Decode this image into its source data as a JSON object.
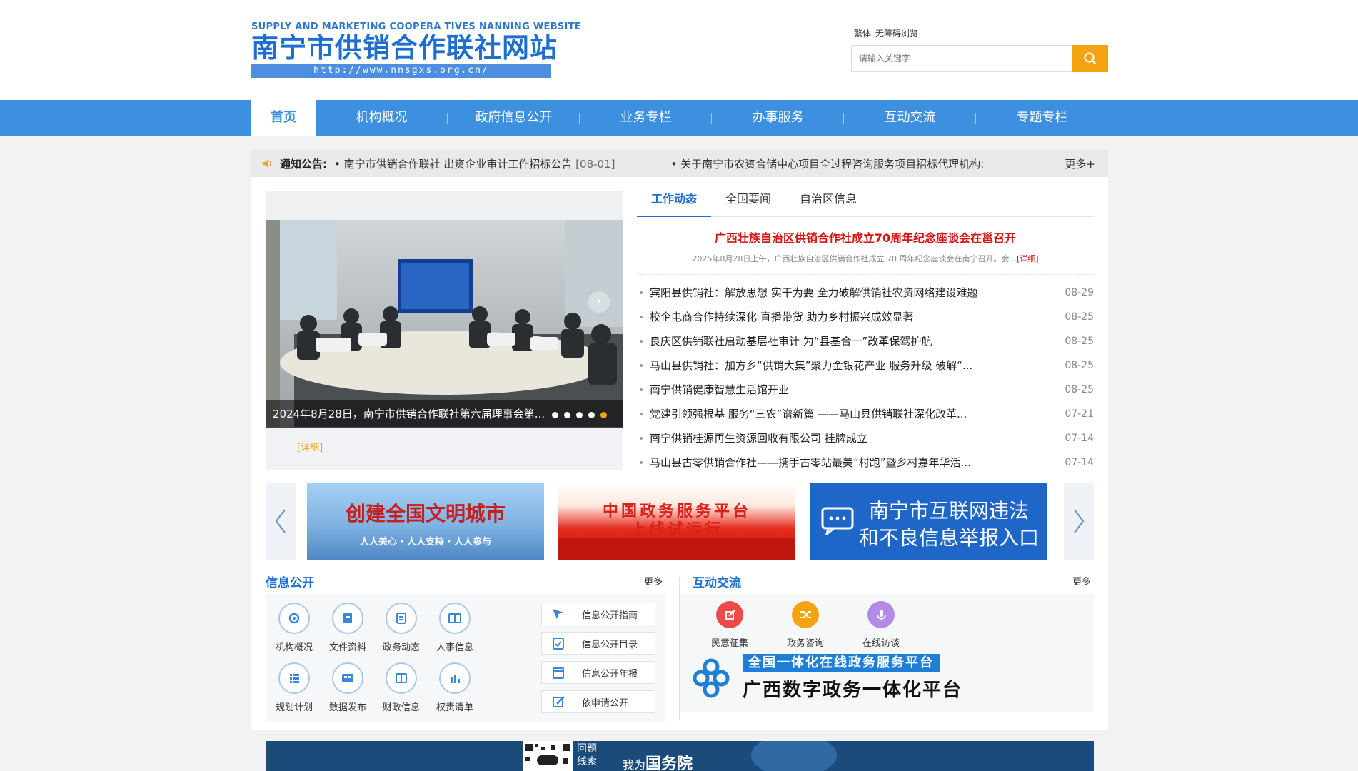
{
  "site": {
    "logo_en": "SUPPLY AND MARKETING COOPERA TIVES NANNING WEBSITE",
    "logo_cn": "南宁市供销合作联社网站",
    "logo_url": "http://www.nnsgxs.org.cn/"
  },
  "tools": {
    "traditional": "繁体",
    "accessible": "无障碍浏览"
  },
  "search": {
    "placeholder": "请输入关键字",
    "button_icon": "search-icon"
  },
  "nav": {
    "items": [
      {
        "label": "首页",
        "active": true
      },
      {
        "label": "机构概况"
      },
      {
        "label": "政府信息公开"
      },
      {
        "label": "业务专栏"
      },
      {
        "label": "办事服务"
      },
      {
        "label": "互动交流"
      },
      {
        "label": "专题专栏"
      }
    ]
  },
  "notice": {
    "label": "通知公告:",
    "items": [
      {
        "text": "• 南宁市供销合作联社 出资企业审计工作招标公告",
        "date": "[08-01]"
      },
      {
        "text": "• 关于南宁市农资合储中心项目全过程咨询服务项目招标代理机构:",
        "date": ""
      }
    ],
    "more": "更多+"
  },
  "slider": {
    "caption": "2024年8月28日，南宁市供销合作联社第六届理事会第...",
    "detail": "[详细]",
    "dots": 5,
    "active_dot": 5
  },
  "news": {
    "tabs": [
      "工作动态",
      "全国要闻",
      "自治区信息"
    ],
    "active_tab": 0,
    "headline": "广西壮族自治区供销合作社成立70周年纪念座谈会在邕召开",
    "summary": "2025年8月28日上午，广西壮族自治区供销合作社成立 70 周年纪念座谈会在南宁召开。会...",
    "summary_link": "[详细]",
    "items": [
      {
        "title": "宾阳县供销社：解放思想   实干为要 全力破解供销社农资网络建设难题",
        "date": "08-29"
      },
      {
        "title": "校企电商合作持续深化 直播带货 助力乡村振兴成效显著",
        "date": "08-25"
      },
      {
        "title": "良庆区供销联社启动基层社审计 为“县基合一”改革保驾护航",
        "date": "08-25"
      },
      {
        "title": "马山县供销社：加方乡“供销大集”聚力金银花产业 服务升级 破解“...",
        "date": "08-25"
      },
      {
        "title": "南宁供销健康智慧生活馆开业",
        "date": "08-25"
      },
      {
        "title": "党建引领强根基 服务“三农”谱新篇 ——马山县供销联社深化改革...",
        "date": "07-21"
      },
      {
        "title": "南宁供销桂源再生资源回收有限公司 挂牌成立",
        "date": "07-14"
      },
      {
        "title": "马山县古零供销合作社——携手古零站最美“村跑”暨乡村嘉年华活...",
        "date": "07-14"
      }
    ]
  },
  "banners": [
    {
      "title": "创建全国文明城市",
      "subtitle": "人人关心 · 人人支持 · 人人参与"
    },
    {
      "title": "中国政务服务平台",
      "subtitle": "上线试运行"
    },
    {
      "title": "南宁市互联网违法",
      "subtitle": "和不良信息举报入口"
    }
  ],
  "info": {
    "title": "信息公开",
    "more": "更多",
    "icons": [
      {
        "label": "机构概况",
        "icon": "gear-icon"
      },
      {
        "label": "文件资料",
        "icon": "document-icon"
      },
      {
        "label": "政务动态",
        "icon": "news-icon"
      },
      {
        "label": "人事信息",
        "icon": "book-icon"
      },
      {
        "label": "规划计划",
        "icon": "list-icon"
      },
      {
        "label": "数据发布",
        "icon": "data-icon"
      },
      {
        "label": "财政信息",
        "icon": "finance-icon"
      },
      {
        "label": "权责清单",
        "icon": "chart-icon"
      }
    ],
    "links": [
      {
        "label": "信息公开指南",
        "icon": "cursor-icon"
      },
      {
        "label": "信息公开目录",
        "icon": "clipboard-icon"
      },
      {
        "label": "信息公开年报",
        "icon": "calendar-icon"
      },
      {
        "label": "依申请公开",
        "icon": "edit-icon"
      }
    ]
  },
  "interact": {
    "title": "互动交流",
    "more": "更多",
    "icons": [
      {
        "label": "民意征集",
        "icon": "pencil-icon",
        "color": "#ef4a4a"
      },
      {
        "label": "政务咨询",
        "icon": "shuffle-icon",
        "color": "#f5a311"
      },
      {
        "label": "在线访谈",
        "icon": "microphone-icon",
        "color": "#b28ae8"
      }
    ],
    "platform_top": "全国一体化在线政务服务平台",
    "platform_bottom": "广西数字政务一体化平台"
  },
  "bottom_strip": {
    "qr_label_1": "问题",
    "qr_label_2": "线索",
    "slogan_1": "我为",
    "slogan_2": "国务院"
  }
}
